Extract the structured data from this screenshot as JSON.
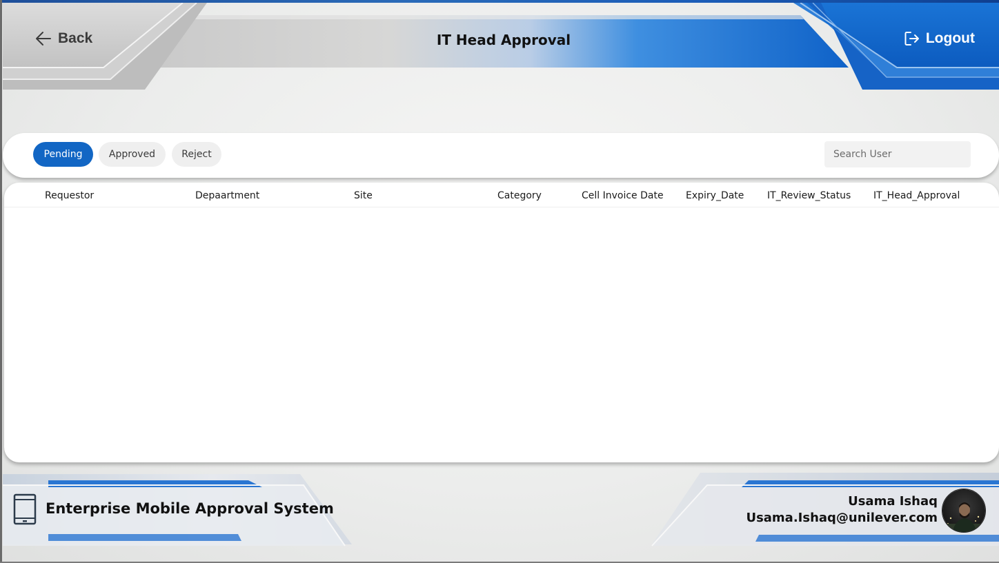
{
  "header": {
    "back_label": "Back",
    "title": "IT Head Approval",
    "logout_label": "Logout"
  },
  "filters": {
    "tabs": [
      {
        "label": "Pending",
        "active": true
      },
      {
        "label": "Approved",
        "active": false
      },
      {
        "label": "Reject",
        "active": false
      }
    ],
    "search_placeholder": "Search User",
    "search_value": ""
  },
  "table": {
    "columns": [
      "Requestor",
      "Depaartment",
      "Site",
      "Category",
      "Cell Invoice Date",
      "Expiry_Date",
      "IT_Review_Status",
      "IT_Head_Approval"
    ],
    "rows": []
  },
  "footer": {
    "app_name": "Enterprise Mobile Approval System",
    "user_name": "Usama Ishaq",
    "user_email": "Usama.Ishaq@unilever.com"
  },
  "icons": {
    "back": "arrow-left-icon",
    "logout": "logout-icon",
    "app": "mobile-device-icon",
    "avatar": "user-avatar"
  },
  "colors": {
    "accent": "#1266c4",
    "header_blue": "#1b6fd1",
    "tab_inactive": "#efefef",
    "panel": "#ffffff"
  }
}
